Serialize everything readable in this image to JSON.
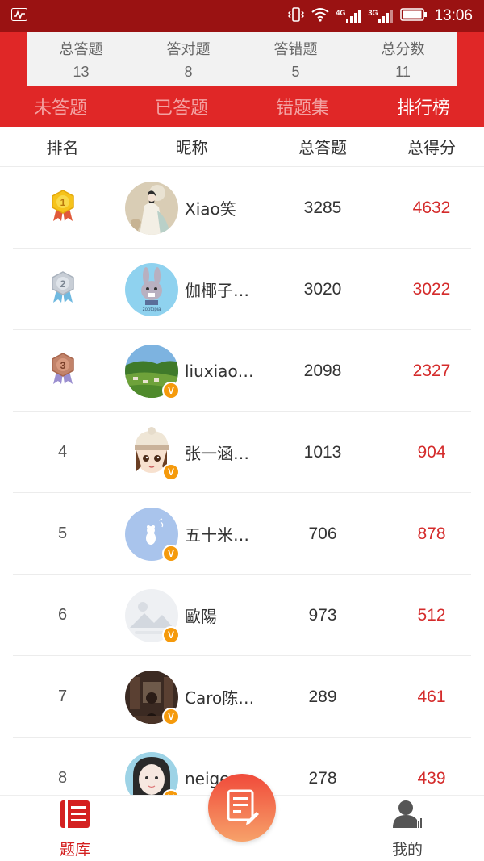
{
  "status_bar": {
    "time": "13:06",
    "net1": "4G",
    "net2": "3G"
  },
  "stats": [
    {
      "label": "总答题",
      "value": "13"
    },
    {
      "label": "答对题",
      "value": "8"
    },
    {
      "label": "答错题",
      "value": "5"
    },
    {
      "label": "总分数",
      "value": "11"
    }
  ],
  "tabs": [
    {
      "label": "未答题",
      "active": false
    },
    {
      "label": "已答题",
      "active": false
    },
    {
      "label": "错题集",
      "active": false
    },
    {
      "label": "排行榜",
      "active": true
    }
  ],
  "table": {
    "headers": {
      "rank": "排名",
      "nickname": "昵称",
      "total": "总答题",
      "score": "总得分"
    },
    "rows": [
      {
        "rank": "1",
        "medal": "gold-medal-icon",
        "nickname": "Xiao笑",
        "total": "3285",
        "score": "4632",
        "verified": false,
        "avatar": "avatar-girl-painting"
      },
      {
        "rank": "2",
        "medal": "silver-medal-icon",
        "nickname": "伽椰子…",
        "total": "3020",
        "score": "3022",
        "verified": false,
        "avatar": "avatar-bunny"
      },
      {
        "rank": "3",
        "medal": "bronze-medal-icon",
        "nickname": "liuxiao…",
        "total": "2098",
        "score": "2327",
        "verified": true,
        "avatar": "avatar-landscape"
      },
      {
        "rank": "4",
        "medal": "",
        "nickname": "张一涵…",
        "total": "1013",
        "score": "904",
        "verified": true,
        "avatar": "avatar-cartoon-girl"
      },
      {
        "rank": "5",
        "medal": "",
        "nickname": "五十米…",
        "total": "706",
        "score": "878",
        "verified": true,
        "avatar": "avatar-blue-bear"
      },
      {
        "rank": "6",
        "medal": "",
        "nickname": "歐陽",
        "total": "973",
        "score": "512",
        "verified": true,
        "avatar": "avatar-placeholder"
      },
      {
        "rank": "7",
        "medal": "",
        "nickname": "Caro陈…",
        "total": "289",
        "score": "461",
        "verified": true,
        "avatar": "avatar-dark-room"
      },
      {
        "rank": "8",
        "medal": "",
        "nickname": "neige",
        "total": "278",
        "score": "439",
        "verified": true,
        "avatar": "avatar-girl-photo"
      }
    ]
  },
  "bottom_nav": {
    "left_label": "题库",
    "right_label": "我的"
  },
  "colors": {
    "brand_red": "#e02727",
    "score_red": "#d42b2b",
    "badge_orange": "#f59a0c"
  }
}
